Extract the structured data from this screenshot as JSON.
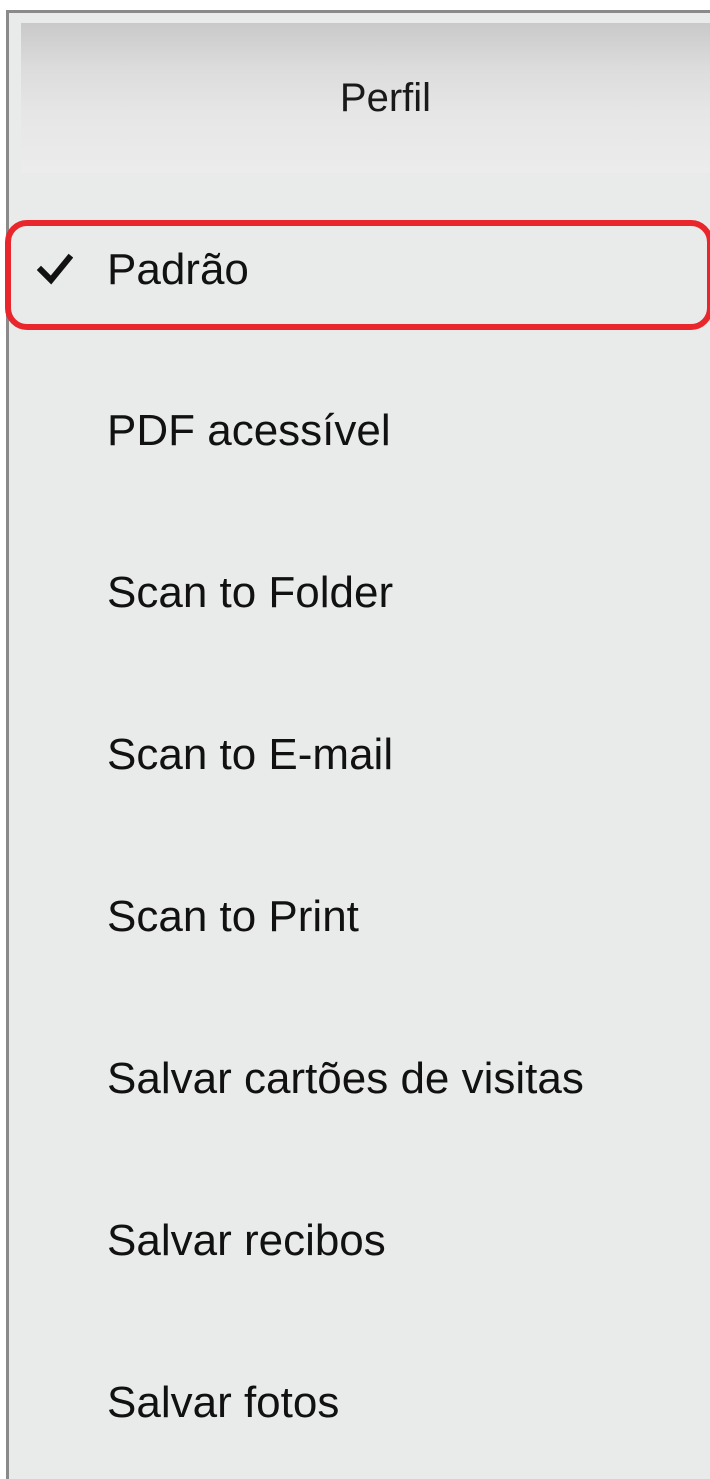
{
  "menu": {
    "header": "Perfil",
    "items": [
      {
        "label": "Padrão",
        "checked": true
      },
      {
        "label": "PDF acessível",
        "checked": false
      },
      {
        "label": "Scan to Folder",
        "checked": false
      },
      {
        "label": "Scan to E-mail",
        "checked": false
      },
      {
        "label": "Scan to Print",
        "checked": false
      },
      {
        "label": "Salvar cartões de visitas",
        "checked": false
      },
      {
        "label": "Salvar recibos",
        "checked": false
      },
      {
        "label": "Salvar fotos",
        "checked": false
      }
    ]
  },
  "colors": {
    "highlight": "#e8262b",
    "menu_background": "#e9eaea",
    "text": "#111111"
  }
}
